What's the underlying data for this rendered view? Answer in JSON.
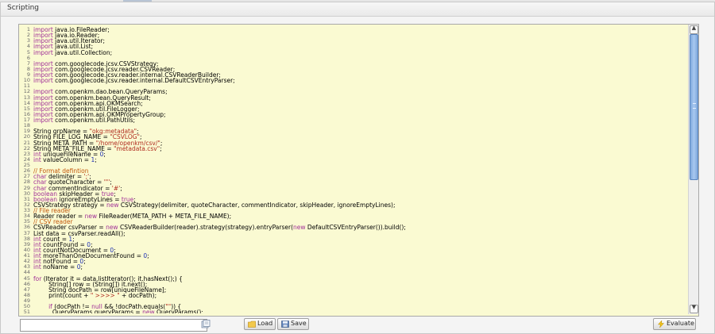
{
  "panel": {
    "title": "Scripting"
  },
  "code_lines": [
    [
      [
        "k",
        "import"
      ],
      [
        "p",
        " java.io.FileReader;"
      ]
    ],
    [
      [
        "k",
        "import"
      ],
      [
        "p",
        " java.io.Reader;"
      ]
    ],
    [
      [
        "k",
        "import"
      ],
      [
        "p",
        " java.util.Iterator;"
      ]
    ],
    [
      [
        "k",
        "import"
      ],
      [
        "p",
        " java.util.List;"
      ]
    ],
    [
      [
        "k",
        "import"
      ],
      [
        "p",
        " java.util.Collection;"
      ]
    ],
    [],
    [
      [
        "k",
        "import"
      ],
      [
        "p",
        " com.googlecode.jcsv.CSVStrategy;"
      ]
    ],
    [
      [
        "k",
        "import"
      ],
      [
        "p",
        " com.googlecode.jcsv.reader.CSVReader;"
      ]
    ],
    [
      [
        "k",
        "import"
      ],
      [
        "p",
        " com.googlecode.jcsv.reader.internal.CSVReaderBuilder;"
      ]
    ],
    [
      [
        "k",
        "import"
      ],
      [
        "p",
        " com.googlecode.jcsv.reader.internal.DefaultCSVEntryParser;"
      ]
    ],
    [],
    [
      [
        "k",
        "import"
      ],
      [
        "p",
        " com.openkm.dao.bean.QueryParams;"
      ]
    ],
    [
      [
        "k",
        "import"
      ],
      [
        "p",
        " com.openkm.bean.QueryResult;"
      ]
    ],
    [
      [
        "k",
        "import"
      ],
      [
        "p",
        " com.openkm.api.OKMSearch;"
      ]
    ],
    [
      [
        "k",
        "import"
      ],
      [
        "p",
        " com.openkm.util.FileLogger;"
      ]
    ],
    [
      [
        "k",
        "import"
      ],
      [
        "p",
        " com.openkm.api.OKMPropertyGroup;"
      ]
    ],
    [
      [
        "k",
        "import"
      ],
      [
        "p",
        " com.openkm.util.PathUtils;"
      ]
    ],
    [],
    [
      [
        "p",
        "String grpName = "
      ],
      [
        "s",
        "\"okg:metadata\""
      ],
      [
        "p",
        ";"
      ]
    ],
    [
      [
        "p",
        "String FILE_LOG_NAME = "
      ],
      [
        "s",
        "\"CSVLOG\""
      ],
      [
        "p",
        ";"
      ]
    ],
    [
      [
        "p",
        "String META_PATH = "
      ],
      [
        "s",
        "\"/home/openkm/csv/\""
      ],
      [
        "p",
        ";"
      ]
    ],
    [
      [
        "p",
        "String META_FILE_NAME = "
      ],
      [
        "s",
        "\"metadata.csv\""
      ],
      [
        "p",
        ";"
      ]
    ],
    [
      [
        "k",
        "int"
      ],
      [
        "p",
        " uniqueFileName = "
      ],
      [
        "n",
        "0"
      ],
      [
        "p",
        ";"
      ]
    ],
    [
      [
        "k",
        "int"
      ],
      [
        "p",
        " valueColumn = "
      ],
      [
        "n",
        "1"
      ],
      [
        "p",
        ";"
      ]
    ],
    [],
    [
      [
        "c",
        "// Format defintion"
      ]
    ],
    [
      [
        "k",
        "char"
      ],
      [
        "p",
        " delimiter = "
      ],
      [
        "s",
        "';'"
      ],
      [
        "p",
        ";"
      ]
    ],
    [
      [
        "k",
        "char"
      ],
      [
        "p",
        " quoteCharacter = "
      ],
      [
        "s",
        "'\"'"
      ],
      [
        "p",
        ";"
      ]
    ],
    [
      [
        "k",
        "char"
      ],
      [
        "p",
        " commentIndicator = "
      ],
      [
        "s",
        "'#'"
      ],
      [
        "p",
        ";"
      ]
    ],
    [
      [
        "k",
        "boolean"
      ],
      [
        "p",
        " skipHeader = "
      ],
      [
        "k",
        "true"
      ],
      [
        "p",
        ";"
      ]
    ],
    [
      [
        "k",
        "boolean"
      ],
      [
        "p",
        " ignoreEmptyLines = "
      ],
      [
        "k",
        "true"
      ],
      [
        "p",
        ";"
      ]
    ],
    [
      [
        "p",
        "CSVStrategy strategy = "
      ],
      [
        "k",
        "new"
      ],
      [
        "p",
        " CSVStrategy(delimiter, quoteCharacter, commentIndicator, skipHeader, ignoreEmptyLines);"
      ]
    ],
    [
      [
        "c",
        "// File reader"
      ]
    ],
    [
      [
        "p",
        "Reader reader = "
      ],
      [
        "k",
        "new"
      ],
      [
        "p",
        " FileReader(META_PATH + META_FILE_NAME);"
      ]
    ],
    [
      [
        "c",
        "// CSV reader"
      ]
    ],
    [
      [
        "p",
        "CSVReader csvParser = "
      ],
      [
        "k",
        "new"
      ],
      [
        "p",
        " CSVReaderBuilder(reader).strategy(strategy).entryParser("
      ],
      [
        "k",
        "new"
      ],
      [
        "p",
        " DefaultCSVEntryParser()).build();"
      ]
    ],
    [
      [
        "p",
        "List data = csvParser.readAll();"
      ]
    ],
    [
      [
        "k",
        "int"
      ],
      [
        "p",
        " count = "
      ],
      [
        "n",
        "1"
      ],
      [
        "p",
        ";"
      ]
    ],
    [
      [
        "k",
        "int"
      ],
      [
        "p",
        " countFound = "
      ],
      [
        "n",
        "0"
      ],
      [
        "p",
        ";"
      ]
    ],
    [
      [
        "k",
        "int"
      ],
      [
        "p",
        " countNotDocument = "
      ],
      [
        "n",
        "0"
      ],
      [
        "p",
        ";"
      ]
    ],
    [
      [
        "k",
        "int"
      ],
      [
        "p",
        " moreThanOneDocumentFound = "
      ],
      [
        "n",
        "0"
      ],
      [
        "p",
        ";"
      ]
    ],
    [
      [
        "k",
        "int"
      ],
      [
        "p",
        " notFound = "
      ],
      [
        "n",
        "0"
      ],
      [
        "p",
        ";"
      ]
    ],
    [
      [
        "k",
        "int"
      ],
      [
        "p",
        " noName = "
      ],
      [
        "n",
        "0"
      ],
      [
        "p",
        ";"
      ]
    ],
    [],
    [
      [
        "k",
        "for"
      ],
      [
        "p",
        " (Iterator it = data.listIterator(); it.hasNext();) {"
      ]
    ],
    [
      [
        "p",
        "        String[] row = (String[]) it.next();"
      ]
    ],
    [
      [
        "p",
        "        String docPath = row[uniqueFileName];"
      ]
    ],
    [
      [
        "p",
        "        print(count + "
      ],
      [
        "s",
        "\" >>>> \""
      ],
      [
        "p",
        " + docPath);"
      ]
    ],
    [],
    [
      [
        "p",
        "        "
      ],
      [
        "k",
        "if"
      ],
      [
        "p",
        " (docPath != "
      ],
      [
        "k",
        "null"
      ],
      [
        "p",
        " && !docPath.equals("
      ],
      [
        "s",
        "\"\""
      ],
      [
        "p",
        ")) {"
      ]
    ],
    [
      [
        "p",
        "          QueryParams queryParams = "
      ],
      [
        "k",
        "new"
      ],
      [
        "p",
        " QueryParams();"
      ]
    ]
  ],
  "input": {
    "value": "",
    "placeholder": ""
  },
  "buttons": {
    "load": "Load",
    "save": "Save",
    "evaluate": "Evaluate"
  },
  "icons": {
    "clip": "clip-icon",
    "load": "folder-icon",
    "save": "save-icon",
    "evaluate": "lightning-icon"
  },
  "colors": {
    "editor_background": "#fafad2",
    "keyword": "#a12f97",
    "string": "#b02b1e",
    "comment": "#c1570c",
    "number": "#1c2fb5",
    "scroll_thumb": "#7ea8dc"
  }
}
